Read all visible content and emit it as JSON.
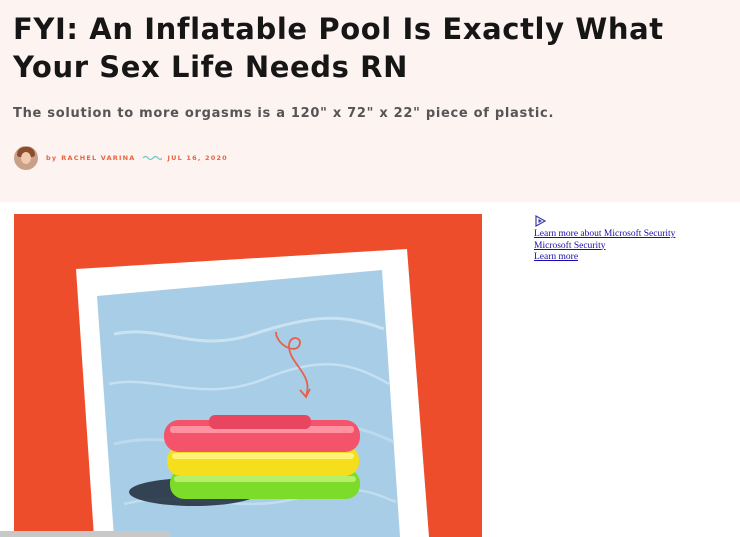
{
  "article": {
    "title": "FYI: An Inflatable Pool Is Exactly What Your Sex Life Needs RN",
    "subtitle": "The solution to more orgasms is a 120\" x 72\" x 22\" piece of plastic.",
    "byline": {
      "prefix": "by",
      "author": "RACHEL VARINA",
      "date": "JUL 16, 2020"
    }
  },
  "ad": {
    "icon": "adchoices-play-icon",
    "links": [
      "Learn more about Microsoft Security",
      "Microsoft Security",
      "Learn more"
    ]
  },
  "colors": {
    "header_bg": "#fdf3f1",
    "accent": "#e8643f",
    "hero_bg": "#ee4d2c",
    "link": "#1a0dab"
  }
}
